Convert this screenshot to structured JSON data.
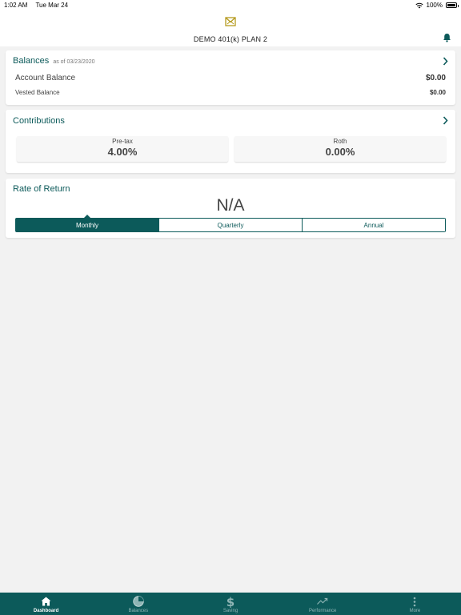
{
  "status_bar": {
    "time": "1:02 AM",
    "date": "Tue Mar 24",
    "battery": "100%"
  },
  "header": {
    "plan_name": "DEMO 401(k) PLAN 2"
  },
  "balances": {
    "title": "Balances",
    "as_of": "as of 03/23/2020",
    "account_label": "Account Balance",
    "account_value": "$0.00",
    "vested_label": "Vested Balance",
    "vested_value": "$0.00"
  },
  "contributions": {
    "title": "Contributions",
    "items": [
      {
        "label": "Pre-tax",
        "value": "4.00%"
      },
      {
        "label": "Roth",
        "value": "0.00%"
      }
    ]
  },
  "rate_of_return": {
    "title": "Rate of Return",
    "value": "N/A",
    "periods": [
      "Monthly",
      "Quarterly",
      "Annual"
    ],
    "selected": "Monthly"
  },
  "tabbar": {
    "items": [
      {
        "label": "Dashboard",
        "icon": "home-icon"
      },
      {
        "label": "Balances",
        "icon": "pie-icon"
      },
      {
        "label": "Saving",
        "icon": "dollar-icon"
      },
      {
        "label": "Performance",
        "icon": "trend-icon"
      },
      {
        "label": "More",
        "icon": "more-icon"
      }
    ],
    "active": "Dashboard"
  },
  "colors": {
    "brand": "#0c5a5a",
    "logo": "#b59a1e",
    "background": "#f2f2f2"
  }
}
